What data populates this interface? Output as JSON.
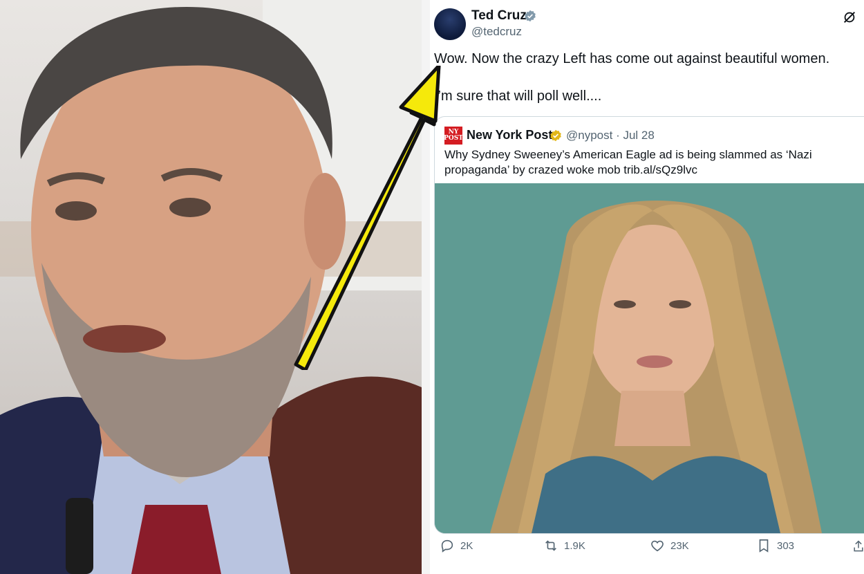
{
  "tweet": {
    "author_name": "Ted Cruz",
    "author_handle": "@tedcruz",
    "text_line1": "Wow. Now the crazy Left has come out against beautiful women.",
    "text_line2": "I’m sure that will poll well....",
    "actions": {
      "replies": "2K",
      "reposts": "1.9K",
      "likes": "23K",
      "bookmarks": "303"
    }
  },
  "quote": {
    "author_name": "New York Post",
    "author_handle": "@nypost",
    "date": "· Jul 28",
    "text": "Why Sydney Sweeney’s American Eagle ad is being slammed as ‘Nazi propaganda’ by crazed woke mob trib.al/sQz9lvc",
    "logo_text": "NEW YORK POST"
  },
  "colors": {
    "verified_blue": "#1d9bf0",
    "verified_gold": "#e2b719",
    "arrow_yellow": "#f5e90b",
    "nypost_red": "#d41c22"
  },
  "icons": [
    "verified-icon",
    "grok-icon",
    "reply-icon",
    "repost-icon",
    "like-icon",
    "bookmark-icon",
    "share-icon"
  ]
}
